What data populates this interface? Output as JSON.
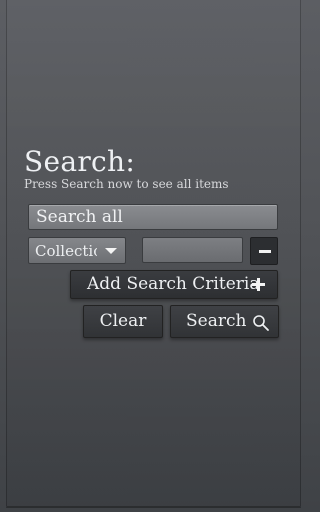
{
  "header": {
    "title": "Search:",
    "subtitle": "Press Search now to see all items"
  },
  "search_all": {
    "value": "Search all"
  },
  "criteria": {
    "select_value": "Collection",
    "value_field": ""
  },
  "buttons": {
    "add_label": "Add Search Criteria",
    "clear_label": "Clear",
    "search_label": "Search"
  },
  "icons": {
    "dropdown": "chevron-down-icon",
    "remove": "minus-icon",
    "add": "plus-icon",
    "search": "search-icon"
  },
  "colors": {
    "background": "#55575b",
    "dark_button": "#2e3033",
    "field": "#7f8185"
  }
}
